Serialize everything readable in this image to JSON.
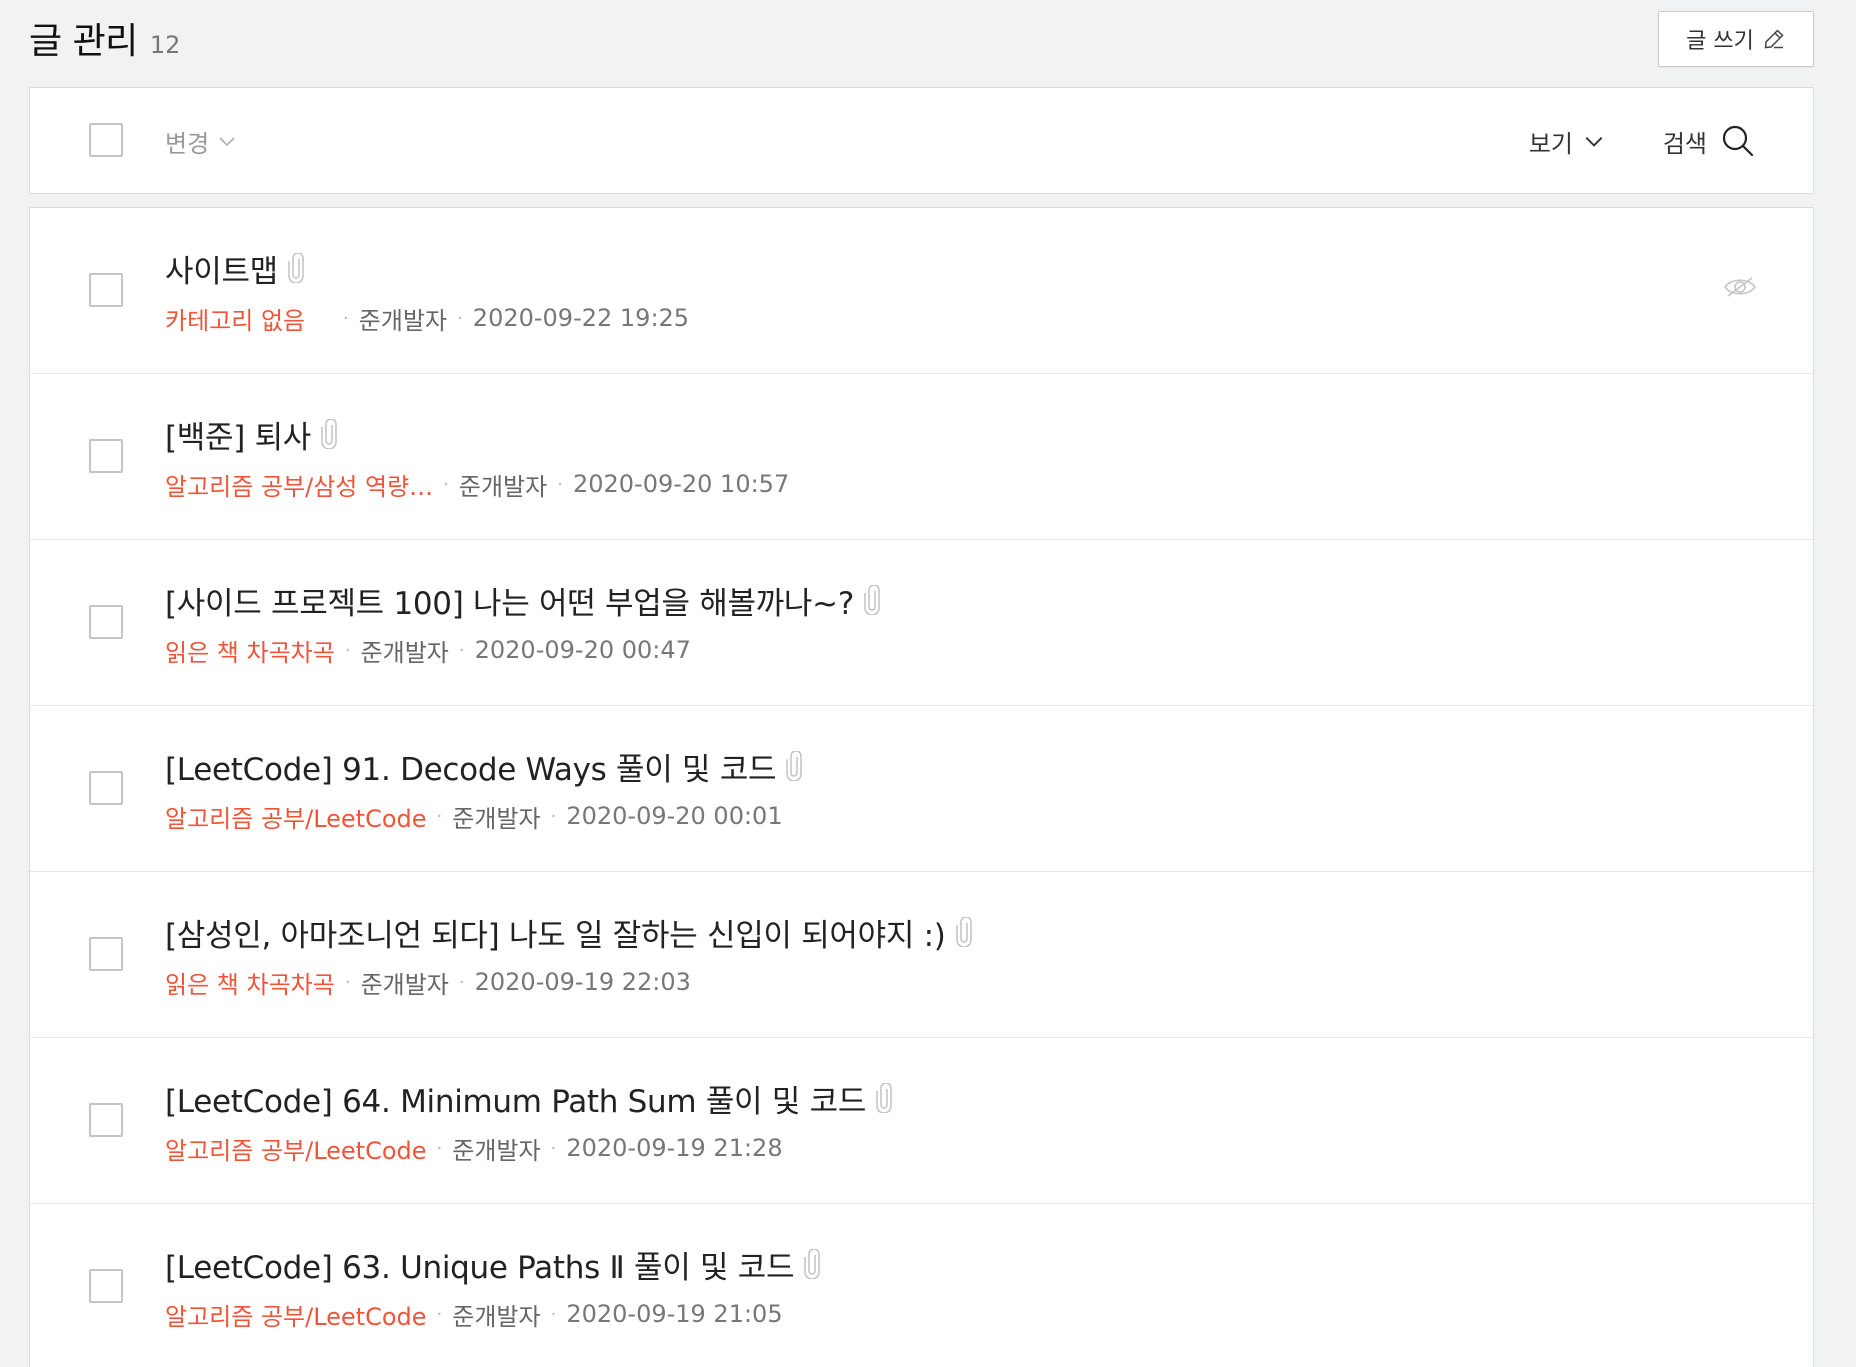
{
  "header": {
    "title": "글 관리",
    "count": "12",
    "write_label": "글 쓰기"
  },
  "toolbar": {
    "change_label": "변경",
    "view_label": "보기",
    "search_label": "검색"
  },
  "icons": {
    "write": "pencil-icon",
    "change": "chevron-down-icon",
    "view": "chevron-down-icon",
    "search": "search-icon",
    "attachment": "paperclip-icon",
    "hidden": "eye-slash-icon"
  },
  "colors": {
    "category": "#f0553a",
    "background": "#f1f2f4"
  },
  "posts": [
    {
      "title": "사이트맵",
      "category": "카테고리 없음",
      "author": "준개발자",
      "date": "2020-09-22 19:25",
      "private": true
    },
    {
      "title": "[백준] 퇴사",
      "category": "알고리즘 공부/삼성 역량…",
      "author": "준개발자",
      "date": "2020-09-20 10:57"
    },
    {
      "title": "[사이드 프로젝트 100] 나는 어떤 부업을 해볼까나~?",
      "category": "읽은 책 차곡차곡",
      "author": "준개발자",
      "date": "2020-09-20 00:47"
    },
    {
      "title": "[LeetCode] 91. Decode Ways 풀이 및 코드",
      "category": "알고리즘 공부/LeetCode",
      "author": "준개발자",
      "date": "2020-09-20 00:01"
    },
    {
      "title": "[삼성인, 아마조니언 되다] 나도 일 잘하는 신입이 되어야지 :)",
      "category": "읽은 책 차곡차곡",
      "author": "준개발자",
      "date": "2020-09-19 22:03"
    },
    {
      "title": "[LeetCode] 64. Minimum Path Sum 풀이 및 코드",
      "category": "알고리즘 공부/LeetCode",
      "author": "준개발자",
      "date": "2020-09-19 21:28"
    },
    {
      "title": "[LeetCode] 63. Unique Paths Ⅱ 풀이 및 코드",
      "category": "알고리즘 공부/LeetCode",
      "author": "준개발자",
      "date": "2020-09-19 21:05"
    }
  ]
}
